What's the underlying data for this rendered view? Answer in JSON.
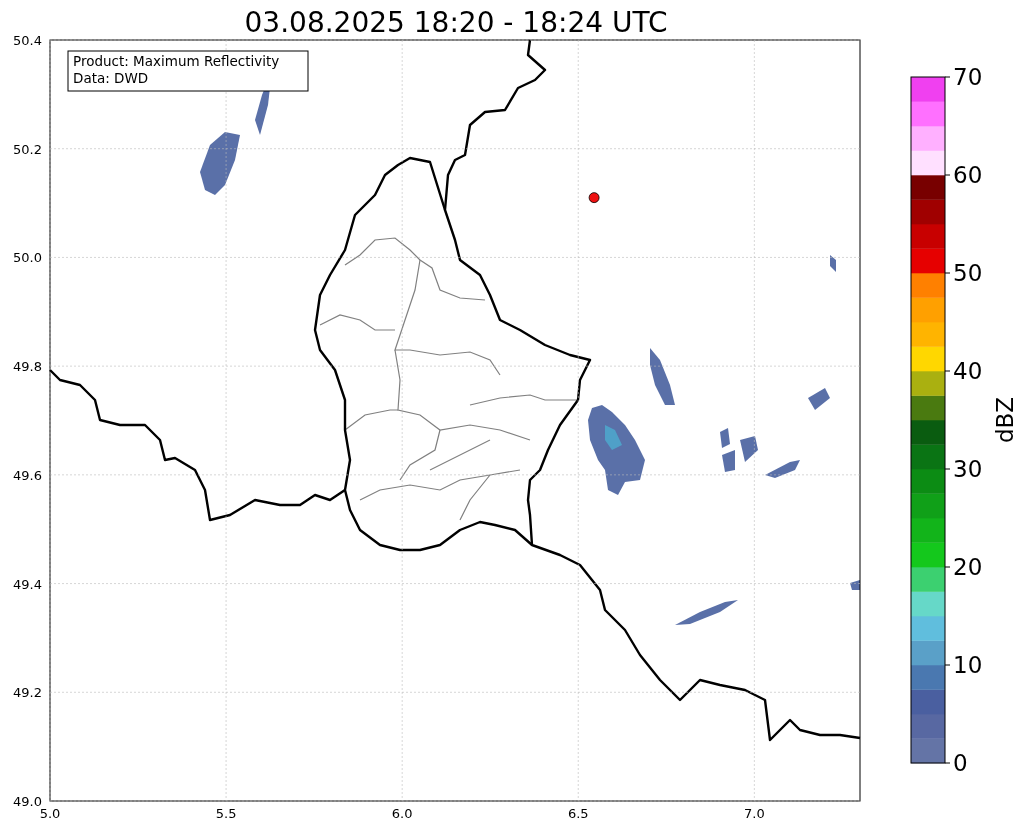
{
  "title": "03.08.2025 18:20 - 18:24 UTC",
  "info_box": [
    "Product: Maximum Reflectivity",
    "Data: DWD"
  ],
  "map": {
    "chart_data": {
      "type": "scatter",
      "grid": true,
      "x": [
        6.545
      ],
      "xlim": [
        5,
        7.3
      ],
      "ylim": [
        49,
        50.4
      ],
      "xticks": [
        {
          "value": 5,
          "label": "5.0"
        },
        {
          "value": 5.5,
          "label": "5.5"
        },
        {
          "value": 6,
          "label": "6.0"
        },
        {
          "value": 6.5,
          "label": "6.5"
        },
        {
          "value": 7,
          "label": "7.0"
        }
      ],
      "yticks": [
        {
          "value": 50.4,
          "label": "50.4"
        },
        {
          "value": 50.2,
          "label": "50.2"
        },
        {
          "value": 50,
          "label": "50.0"
        },
        {
          "value": 49.8,
          "label": "49.8"
        },
        {
          "value": 49.6,
          "label": "49.6"
        },
        {
          "value": 49.4,
          "label": "49.4"
        },
        {
          "value": 49.2,
          "label": "49.2"
        },
        {
          "value": 49,
          "label": "49.0"
        }
      ],
      "series": [
        {
          "color": "#ee1111",
          "values": [
            50.11
          ]
        }
      ]
    }
  },
  "colorbar": {
    "label": "dBZ",
    "ticks": [
      "70",
      "60",
      "50",
      "40",
      "30",
      "20",
      "10",
      "0"
    ]
  }
}
